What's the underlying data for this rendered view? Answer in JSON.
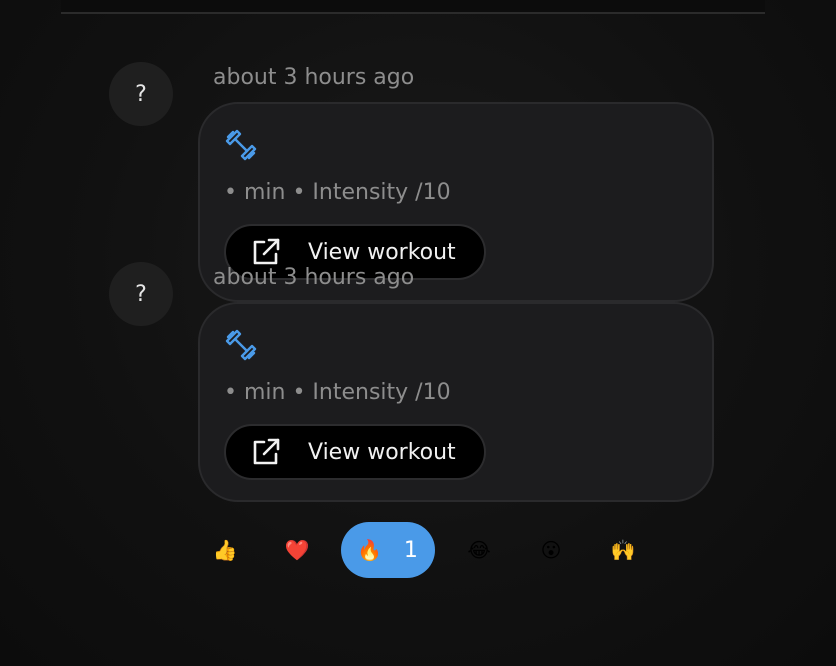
{
  "feed": {
    "posts": [
      {
        "avatar_text": "?",
        "timestamp": "about 3 hours ago",
        "stats": "• min • Intensity /10",
        "view_label": "View workout"
      },
      {
        "avatar_text": "?",
        "timestamp": "about 3 hours ago",
        "stats": "• min • Intensity /10",
        "view_label": "View workout"
      }
    ],
    "reactions": [
      {
        "icon": "thumbs-up-icon",
        "emoji": "👍",
        "count": ""
      },
      {
        "icon": "heart-icon",
        "emoji": "❤️",
        "count": ""
      },
      {
        "icon": "fire-icon",
        "emoji": "🔥",
        "count": "1",
        "active": true
      },
      {
        "icon": "laughing-icon",
        "emoji": "😂",
        "count": ""
      },
      {
        "icon": "surprised-icon",
        "emoji": "😮",
        "count": ""
      },
      {
        "icon": "raised-hands-icon",
        "emoji": "🙌",
        "count": ""
      }
    ]
  },
  "colors": {
    "accent": "#4a9ae8",
    "card_bg": "#1c1c1e",
    "muted_text": "#8d8d8d"
  }
}
